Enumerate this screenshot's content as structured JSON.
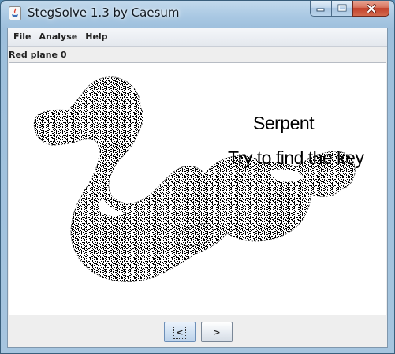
{
  "window": {
    "title": "StegSolve 1.3 by Caesum",
    "icons": {
      "app": "java-icon",
      "minimize": "minimize-icon",
      "maximize": "maximize-icon",
      "close": "close-icon"
    }
  },
  "menu": {
    "file": "File",
    "analyse": "Analyse",
    "help": "Help"
  },
  "view": {
    "plane_label": "Red plane 0"
  },
  "image": {
    "title": "Serpent",
    "subtitle": "Try to find the key"
  },
  "nav": {
    "prev_label": "<",
    "next_label": ">"
  },
  "colors": {
    "titlebar": "#a9c8e3",
    "close_button": "#c2402a",
    "client_bg": "#eeeeee",
    "image_bg": "#ffffff"
  }
}
